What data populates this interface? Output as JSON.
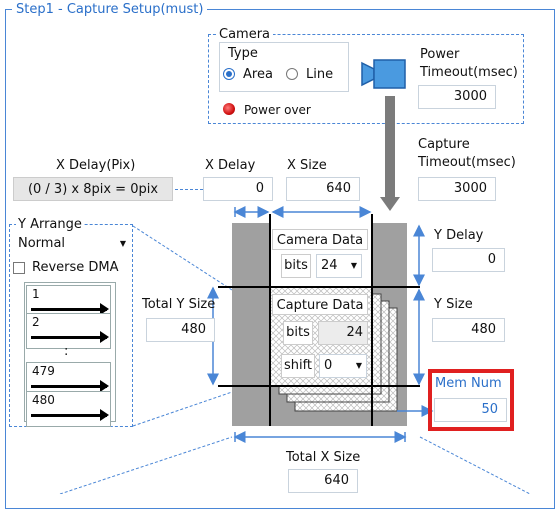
{
  "group_title": "Step1 - Capture Setup(must)",
  "camera": {
    "title": "Camera",
    "type_label": "Type",
    "type_area": "Area",
    "type_line": "Line",
    "power_over": "Power over",
    "power_timeout_label_1": "Power",
    "power_timeout_label_2": "Timeout(msec)",
    "power_timeout_value": "3000"
  },
  "capture_timeout": {
    "label_1": "Capture",
    "label_2": "Timeout(msec)",
    "value": "3000"
  },
  "x_delay_pix": {
    "label": "X Delay(Pix)",
    "formula": "(0 / 3) x 8pix = 0pix"
  },
  "x_delay": {
    "label": "X Delay",
    "value": "0"
  },
  "x_size": {
    "label": "X Size",
    "value": "640"
  },
  "y_arrange": {
    "title": "Y Arrange",
    "mode": "Normal",
    "reverse_dma": "Reverse DMA",
    "rows": [
      "1",
      "2",
      "479",
      "480"
    ],
    "ellipsis": ":"
  },
  "camera_data": {
    "title": "Camera Data",
    "bits_label": "bits",
    "bits_value": "24"
  },
  "capture_data": {
    "title": "Capture Data",
    "bits_label": "bits",
    "bits_value": "24",
    "shift_label": "shift",
    "shift_value": "0"
  },
  "total_y_size": {
    "label": "Total Y Size",
    "value": "480"
  },
  "y_delay": {
    "label": "Y Delay",
    "value": "0"
  },
  "y_size": {
    "label": "Y Size",
    "value": "480"
  },
  "mem_num": {
    "label": "Mem Num",
    "value": "50"
  },
  "total_x_size": {
    "label": "Total X Size",
    "value": "640"
  },
  "colors": {
    "accent": "#4a86d6",
    "highlight": "#e02020",
    "power_led": "#e02020"
  }
}
